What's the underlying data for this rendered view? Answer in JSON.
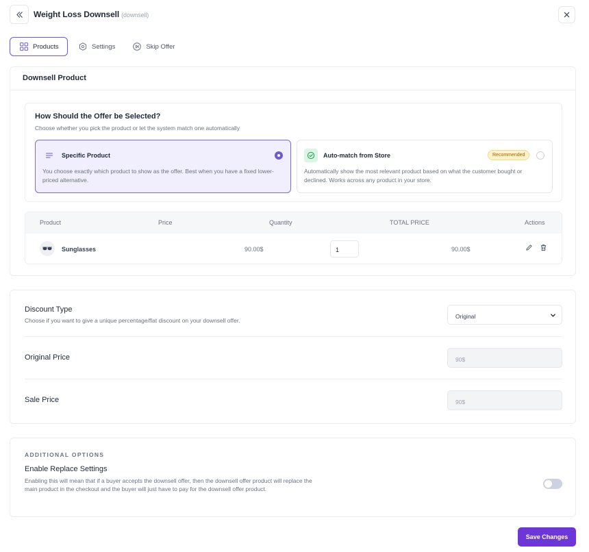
{
  "header": {
    "title": "Weight Loss Downsell",
    "subtitle": "(downsell)"
  },
  "tabs": [
    {
      "label": "Products",
      "icon": "grid-icon",
      "active": true
    },
    {
      "label": "Settings",
      "icon": "hexagon-settings-icon",
      "active": false
    },
    {
      "label": "Skip Offer",
      "icon": "skip-forward-icon",
      "active": false
    }
  ],
  "downsell_product": {
    "heading": "Downsell Product",
    "question": "How Should the Offer be Selected?",
    "question_desc": "Choose whether you pick the product or let the system match one automatically",
    "options": [
      {
        "title": "Specific Product",
        "desc": "You choose exactly which product to show as the offer. Best when you have a fixed lower-priced alternative.",
        "selected": true,
        "icon": "list-lines-icon"
      },
      {
        "title": "Auto-match from Store",
        "desc": "Automatically show the most relevant product based on what the customer bought or declined. Works across any product in your store.",
        "badge": "Recommended",
        "selected": false,
        "icon": "check-circle-icon"
      }
    ],
    "table": {
      "headers": [
        "Product",
        "Price",
        "Quantity",
        "TOTAL PRICE",
        "Actions"
      ],
      "rows": [
        {
          "name": "Sunglasses",
          "price": "90.00$",
          "quantity": "1",
          "total": "90.00$"
        }
      ]
    }
  },
  "pricing": {
    "discount_type_label": "Discount Type",
    "discount_type_desc": "Choose if you want to give a unique percentage/flat discount on your downsell offer.",
    "discount_type_value": "Original",
    "original_price_label": "Original Price",
    "original_price_value": "90$",
    "sale_price_label": "Sale Price",
    "sale_price_value": "90$"
  },
  "additional": {
    "section_title": "ADDITIONAL OPTIONS",
    "replace_label": "Enable Replace Settings",
    "replace_desc": "Enabling this will mean that if a buyer accepts the downsell offer, then the downsell offer product will replace the main product in the checkout and the buyer will just have to pay for the downsell offer product.",
    "replace_enabled": false
  },
  "footer": {
    "save_label": "Save Changes"
  },
  "colors": {
    "accent": "#6d36d8",
    "selected_bg": "#f1effd",
    "badge_bg": "#fdf1c7"
  }
}
